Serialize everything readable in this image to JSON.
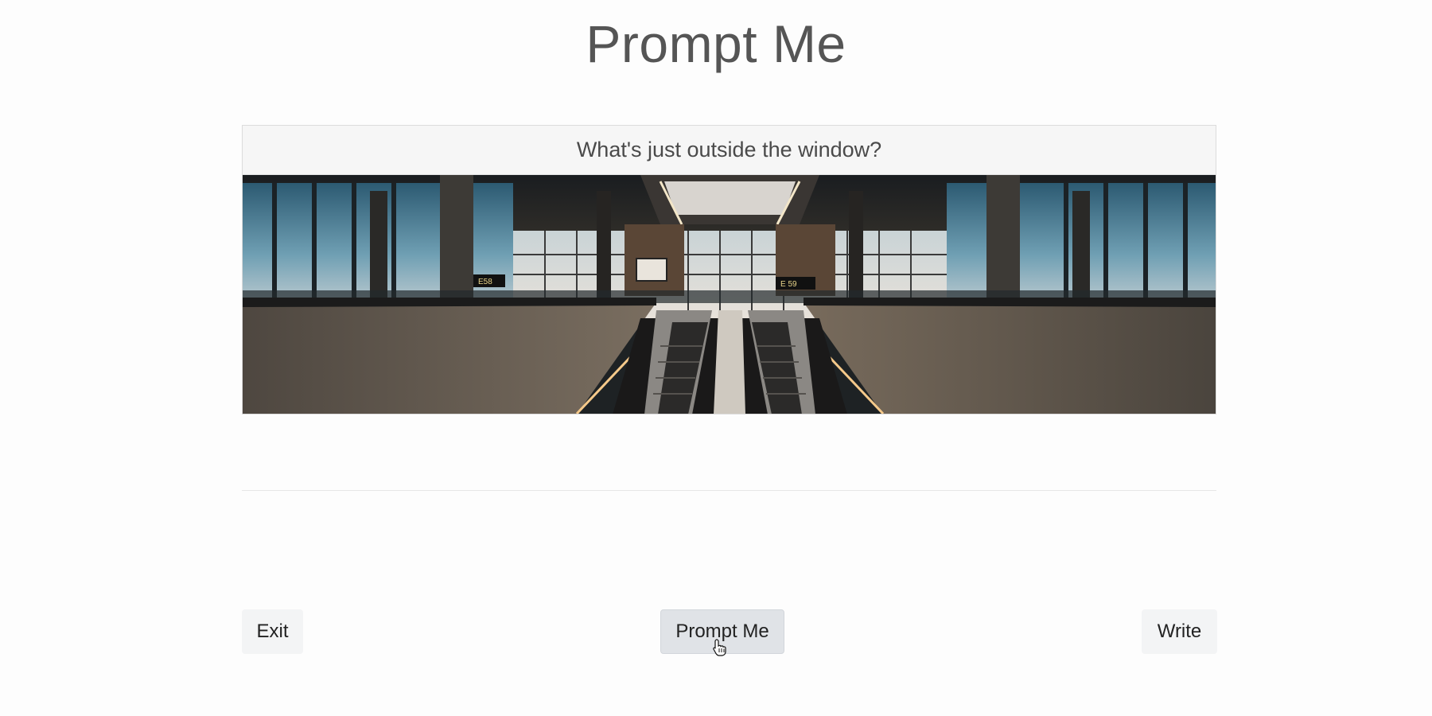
{
  "header": {
    "title": "Prompt Me"
  },
  "prompt_card": {
    "question": "What's just outside the window?",
    "image_alt": "Airport terminal interior with escalators leading down between concrete walls and large windows",
    "gate_signs": [
      "E58",
      "E 59"
    ]
  },
  "footer": {
    "exit_label": "Exit",
    "prompt_label": "Prompt Me",
    "write_label": "Write"
  },
  "colors": {
    "title": "#555555",
    "card_header_bg": "#f6f6f6",
    "button_bg": "#f3f4f5",
    "button_active_bg": "#e0e3e7"
  },
  "icons": {
    "cursor": "pointer-hand-icon"
  }
}
